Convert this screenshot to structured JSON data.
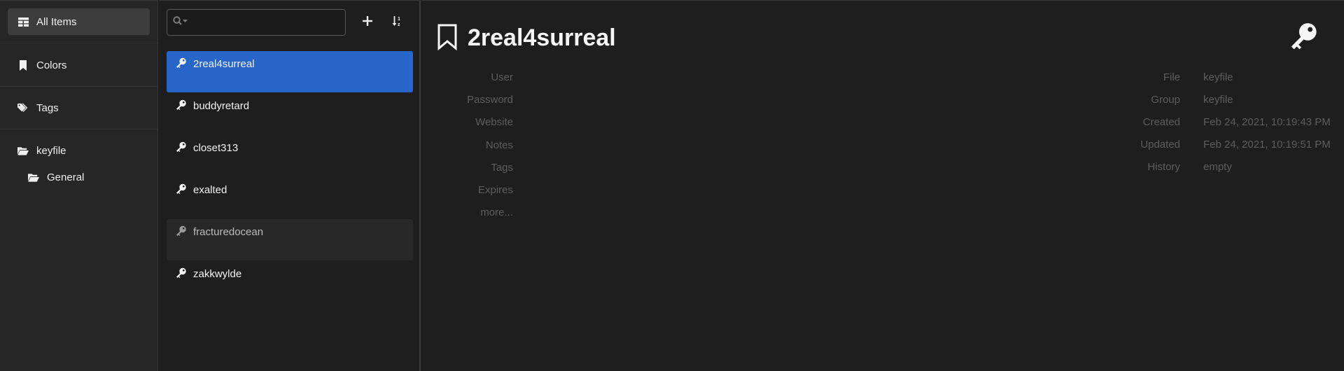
{
  "sidebar": {
    "all_items": "All Items",
    "colors": "Colors",
    "tags": "Tags",
    "file": "keyfile",
    "group": "General"
  },
  "list": {
    "search_value": "",
    "entries": [
      {
        "title": "2real4surreal"
      },
      {
        "title": "buddyretard"
      },
      {
        "title": "closet313"
      },
      {
        "title": "exalted"
      },
      {
        "title": "fracturedocean"
      },
      {
        "title": "zakkwylde"
      }
    ]
  },
  "detail": {
    "title": "2real4surreal",
    "left_fields": [
      "User",
      "Password",
      "Website",
      "Notes",
      "Tags",
      "Expires"
    ],
    "more_label": "more...",
    "right_fields": [
      {
        "label": "File",
        "value": "keyfile"
      },
      {
        "label": "Group",
        "value": "keyfile"
      },
      {
        "label": "Created",
        "value": "Feb 24, 2021, 10:19:43 PM"
      },
      {
        "label": "Updated",
        "value": "Feb 24, 2021, 10:19:51 PM"
      },
      {
        "label": "History",
        "value": "empty"
      }
    ]
  },
  "colors": {
    "accent": "#2765c9",
    "background": "#1e1e1e",
    "sidebar": "#262626"
  }
}
